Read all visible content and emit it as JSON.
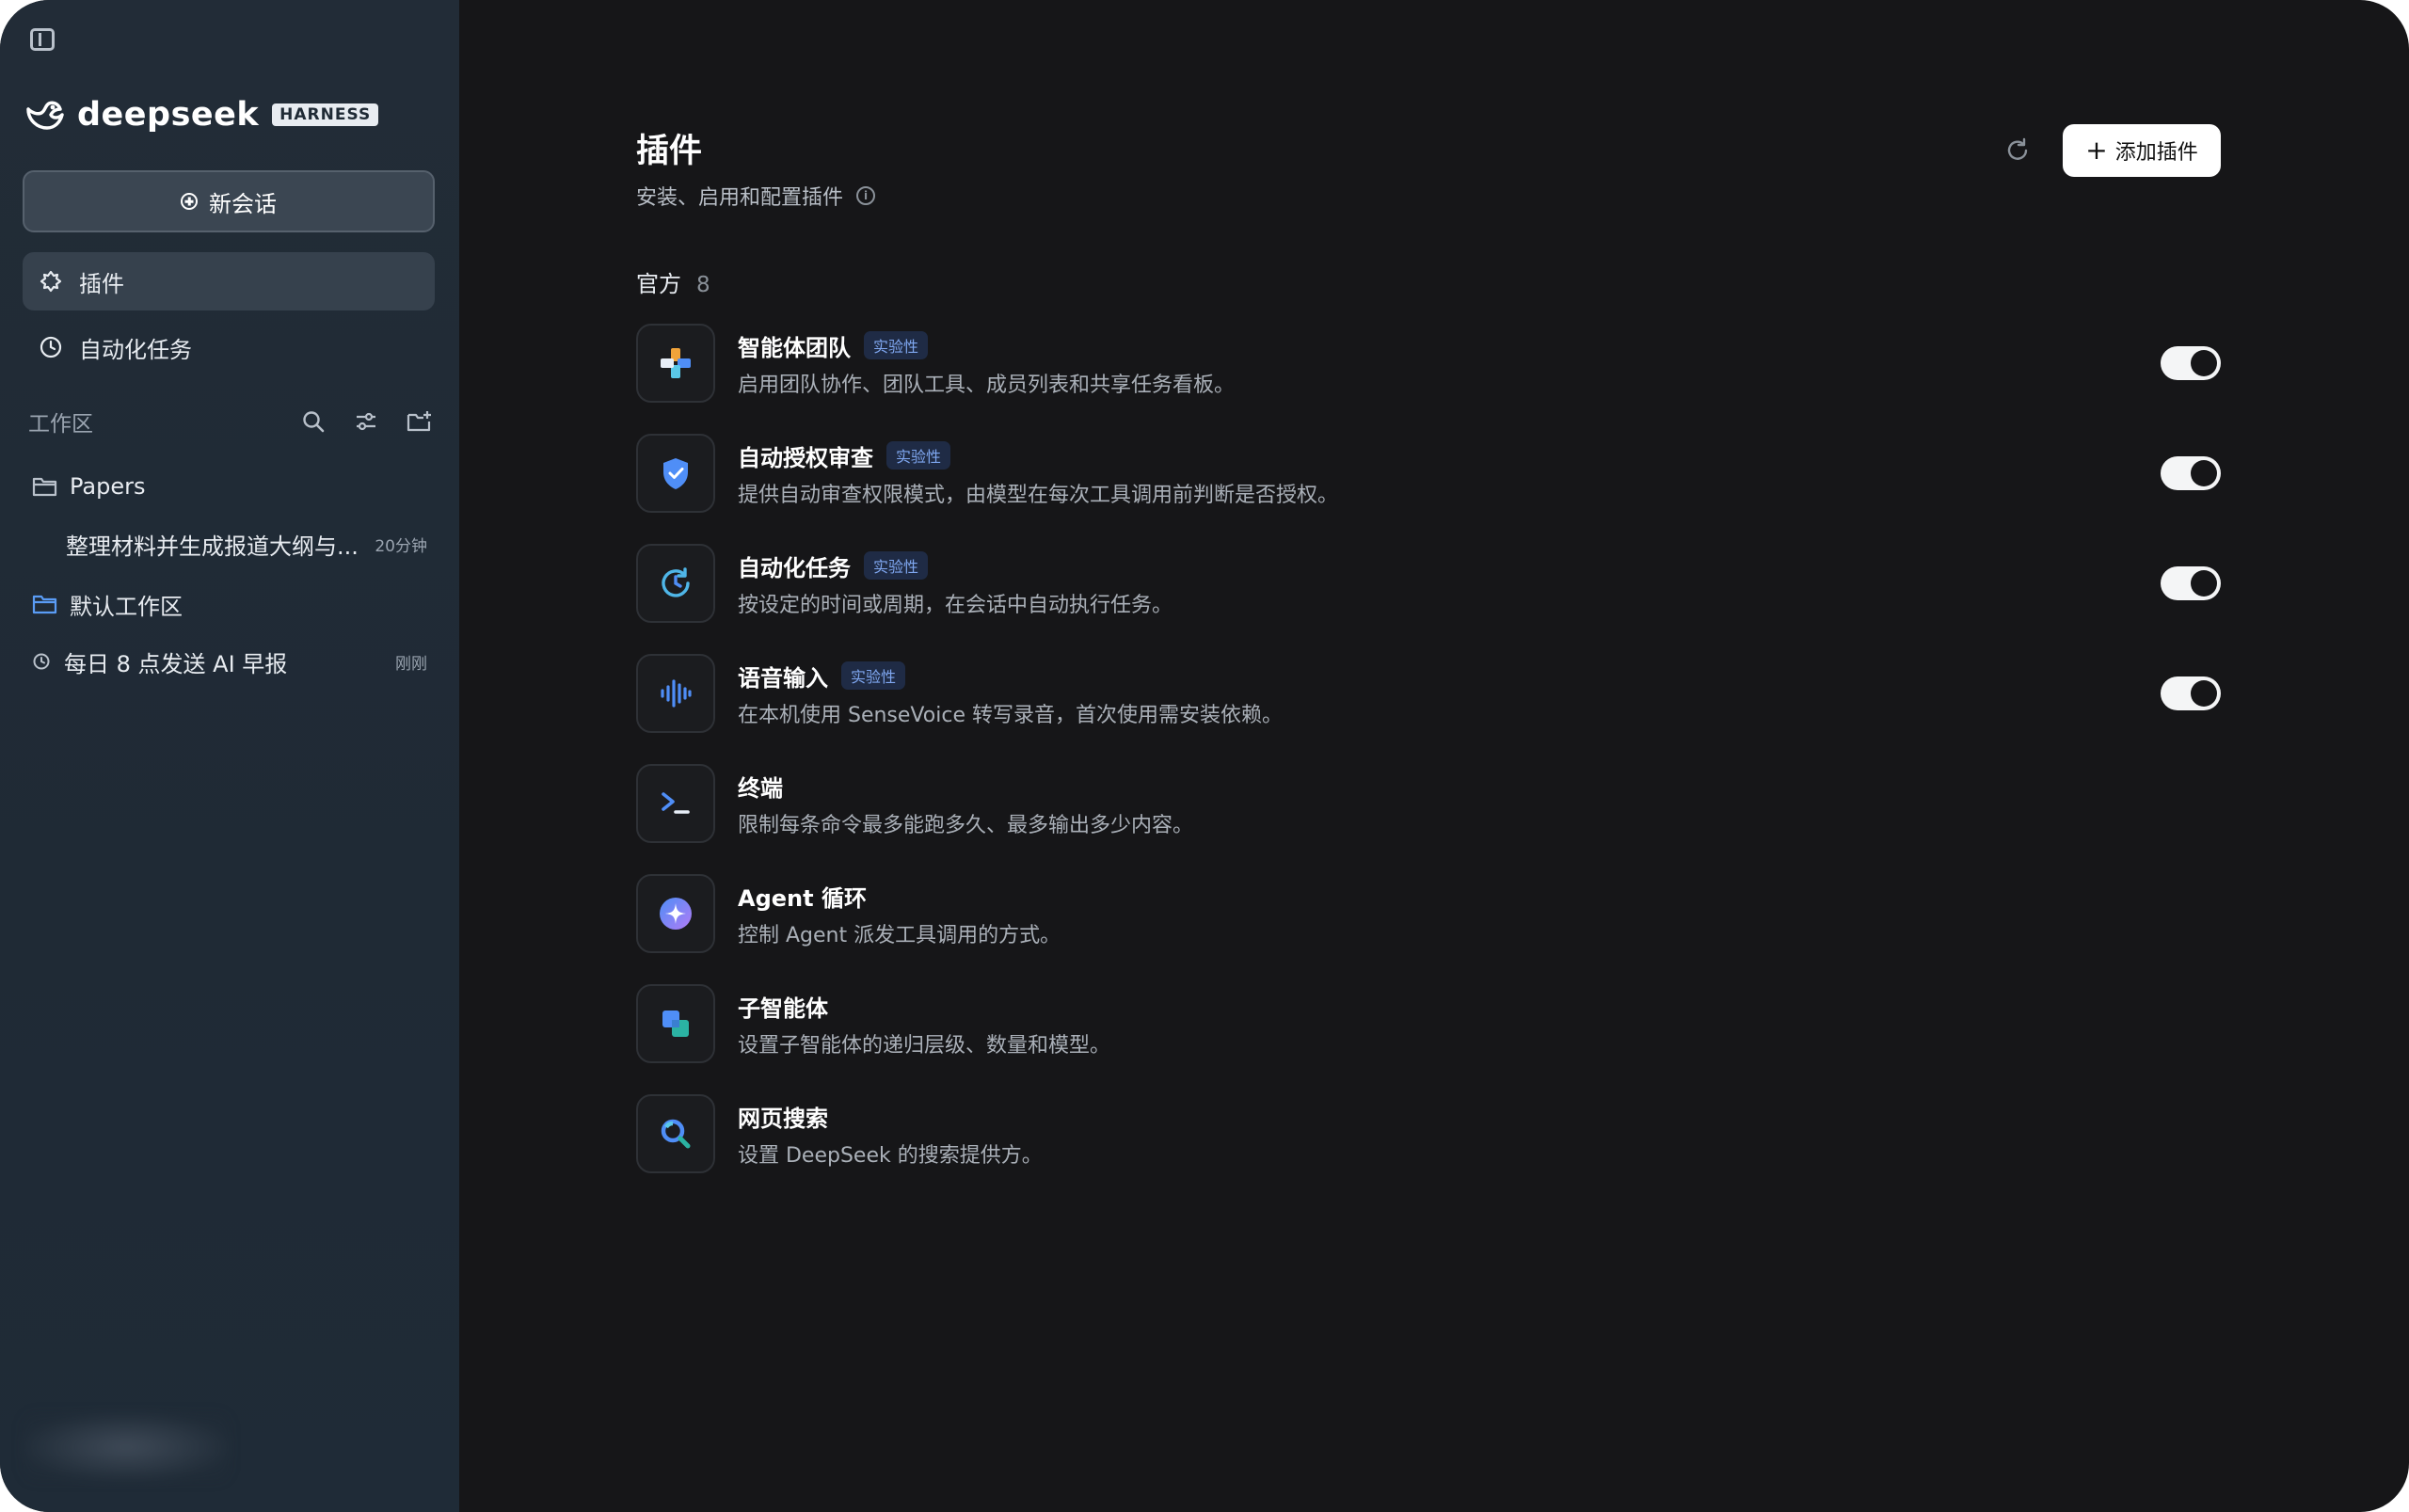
{
  "sidebar": {
    "logo_text": "deepseek",
    "logo_badge": "HARNESS",
    "new_chat_label": "新会话",
    "nav": [
      {
        "label": "插件",
        "icon": "puzzle-icon",
        "active": true
      },
      {
        "label": "自动化任务",
        "icon": "clock-icon",
        "active": false
      }
    ],
    "workspace_title": "工作区",
    "workspace_tools": [
      "search-icon",
      "filter-icon",
      "new-folder-icon"
    ],
    "tree": {
      "folder1": "Papers",
      "item1": {
        "label": "整理材料并生成报道大纲与...",
        "time": "20分钟"
      },
      "folder2": "默认工作区",
      "item2": {
        "label": "每日 8 点发送 AI 早报",
        "time": "刚刚"
      }
    }
  },
  "main": {
    "title": "插件",
    "subtitle": "安装、启用和配置插件",
    "add_button": "添加插件",
    "section_title": "官方",
    "section_count": "8",
    "plugins": [
      {
        "name": "智能体团队",
        "badge": "实验性",
        "desc": "启用团队协作、团队工具、成员列表和共享任务看板。",
        "icon": "team-icon",
        "enabled": true
      },
      {
        "name": "自动授权审查",
        "badge": "实验性",
        "desc": "提供自动审查权限模式，由模型在每次工具调用前判断是否授权。",
        "icon": "shield-icon",
        "enabled": true
      },
      {
        "name": "自动化任务",
        "badge": "实验性",
        "desc": "按设定的时间或周期，在会话中自动执行任务。",
        "icon": "clock-refresh-icon",
        "enabled": true
      },
      {
        "name": "语音输入",
        "badge": "实验性",
        "desc": "在本机使用 SenseVoice 转写录音，首次使用需安装依赖。",
        "icon": "waveform-icon",
        "enabled": true
      },
      {
        "name": "终端",
        "badge": "",
        "desc": "限制每条命令最多能跑多久、最多输出多少内容。",
        "icon": "terminal-icon"
      },
      {
        "name": "Agent 循环",
        "badge": "",
        "desc": "控制 Agent 派发工具调用的方式。",
        "icon": "sparkle-icon"
      },
      {
        "name": "子智能体",
        "badge": "",
        "desc": "设置子智能体的递归层级、数量和模型。",
        "icon": "layers-icon"
      },
      {
        "name": "网页搜索",
        "badge": "",
        "desc": "设置 DeepSeek 的搜索提供方。",
        "icon": "search-icon"
      }
    ]
  },
  "colors": {
    "accent_blue": "#4f8ef7",
    "badge_text": "#7fa7f0",
    "background": "#161618",
    "sidebar": "#222c37"
  }
}
